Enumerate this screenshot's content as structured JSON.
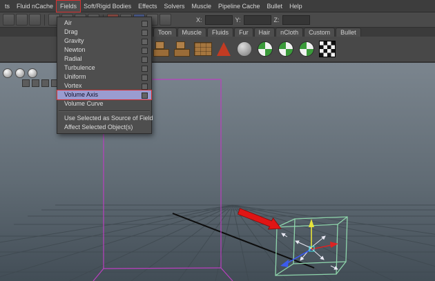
{
  "colors": {
    "annotation-red": "#d83030",
    "menu-highlight": "#9a9cd0",
    "magenta": "#bb3fc0",
    "cube": "#8fd6ac",
    "manip-yellow": "#e8e43a",
    "manip-blue": "#3b5bee",
    "manip-red": "#dd2222",
    "arrow-red": "#e01515",
    "grid": "#3f4950",
    "vp-top": "#7b858e",
    "vp-mid": "#606b74",
    "vp-bot": "#424d56"
  },
  "menubar": {
    "items": [
      {
        "label": "ts"
      },
      {
        "label": "Fluid nCache"
      },
      {
        "label": "Fields",
        "annotated": true
      },
      {
        "label": "Soft/Rigid Bodies"
      },
      {
        "label": "Effects"
      },
      {
        "label": "Solvers"
      },
      {
        "label": "Muscle"
      },
      {
        "label": "Pipeline Cache"
      },
      {
        "label": "Bullet"
      },
      {
        "label": "Help"
      }
    ]
  },
  "fields_menu": {
    "items": [
      {
        "label": "Air",
        "has_option_box": true
      },
      {
        "label": "Drag",
        "has_option_box": true
      },
      {
        "label": "Gravity",
        "has_option_box": true
      },
      {
        "label": "Newton",
        "has_option_box": true
      },
      {
        "label": "Radial",
        "has_option_box": true
      },
      {
        "label": "Turbulence",
        "has_option_box": true
      },
      {
        "label": "Uniform",
        "has_option_box": true
      },
      {
        "label": "Vortex",
        "has_option_box": true
      },
      {
        "label": "Volume Axis",
        "has_option_box": true,
        "highlighted": true,
        "annotated": true
      },
      {
        "label": "Volume Curve",
        "has_option_box": false
      },
      {
        "label": "Use Selected as Source of Field",
        "has_option_box": false,
        "separator_before": true
      },
      {
        "label": "Affect Selected Object(s)",
        "has_option_box": false
      }
    ]
  },
  "transform_entry": {
    "x_label": "X:",
    "y_label": "Y:",
    "z_label": "Z:",
    "x_value": "",
    "y_value": "",
    "z_value": ""
  },
  "shelf": {
    "tabs": [
      "Toon",
      "Muscle",
      "Fluids",
      "Fur",
      "Hair",
      "nCloth",
      "Custom",
      "Bullet"
    ],
    "icons": [
      "box-stack",
      "box-stack",
      "box-wall",
      "cone",
      "sphere",
      "checker-sphere",
      "checker-sphere",
      "checker-sphere",
      "checker-board"
    ]
  },
  "toolbar_icons": [
    "select-hierarchy",
    "select-object",
    "select-component",
    "snap-grid",
    "snap-curve",
    "snap-point",
    "snap-plane",
    "make-live",
    "construction-history",
    "render-current",
    "ipr-render",
    "render-settings"
  ],
  "viewport": {
    "panel_icons": [
      "shaded-ball",
      "wireframe-ball",
      "textured-ball",
      "grid-toggle",
      "camera-toggle",
      "light-toggle",
      "texture-toggle",
      "resolution-toggle"
    ]
  }
}
